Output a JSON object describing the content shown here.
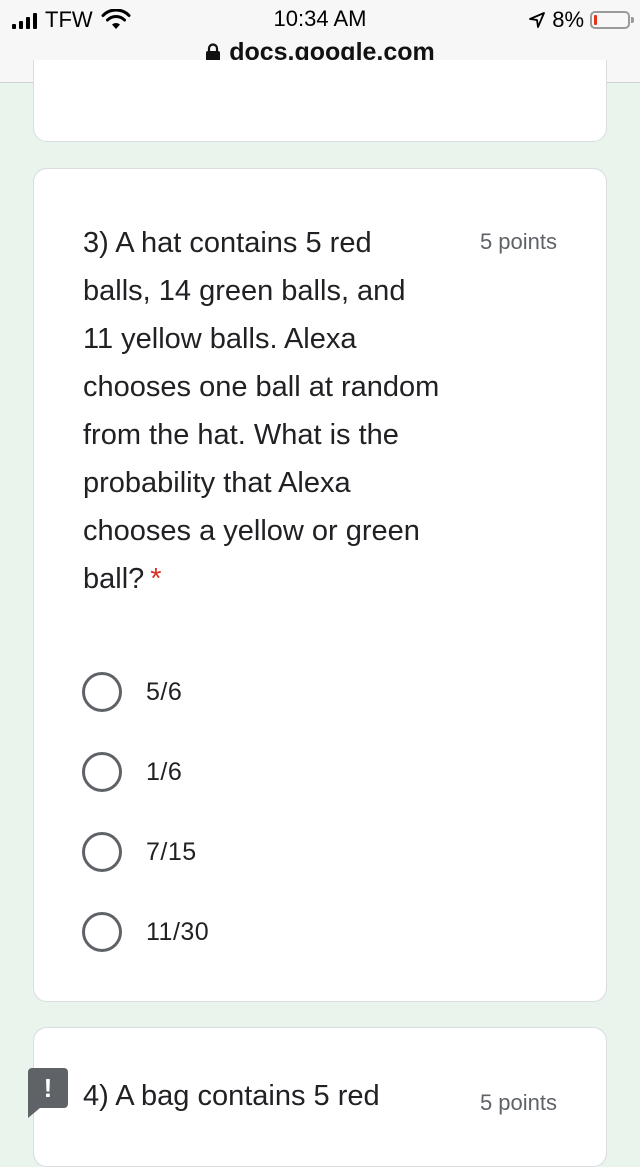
{
  "status_bar": {
    "carrier": "TFW",
    "time": "10:34 AM",
    "battery_percent": "8%",
    "battery_level": 0.08,
    "icons": [
      "signal-icon",
      "wifi-icon",
      "location-arrow-icon",
      "battery-icon"
    ]
  },
  "browser": {
    "url": "docs.google.com",
    "lock_icon": "lock-icon"
  },
  "question3": {
    "text": "3) A hat contains 5 red balls, 14 green balls, and 11 yellow balls. Alexa chooses one ball at random from the hat. What is the probability that Alexa chooses a yellow or green ball?",
    "required_marker": "*",
    "points": "5 points",
    "options": [
      {
        "label": "5/6"
      },
      {
        "label": "1/6"
      },
      {
        "label": "7/15"
      },
      {
        "label": "11/30"
      }
    ]
  },
  "question4": {
    "text": "4) A bag contains 5 red",
    "points": "5 points"
  },
  "feedback_button": {
    "icon": "exclamation-icon",
    "glyph": "!"
  },
  "colors": {
    "background": "#e8f4ec",
    "required": "#d93025",
    "battery_low": "#e0341f"
  }
}
